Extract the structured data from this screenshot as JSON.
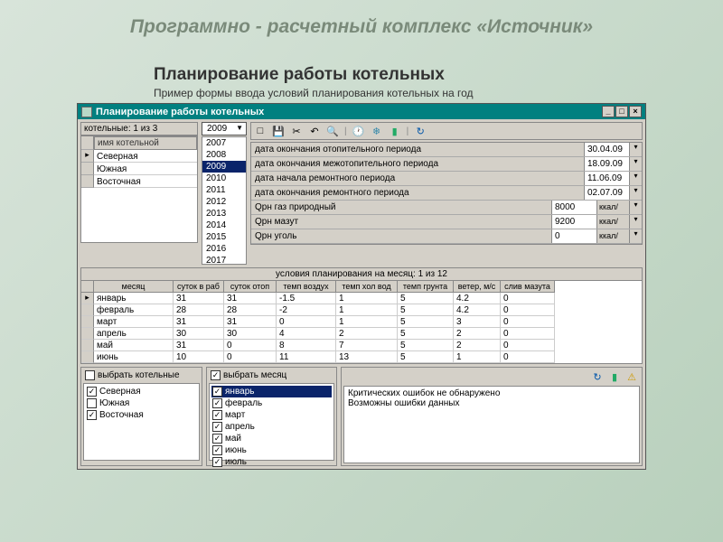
{
  "slide_title": "Программно - расчетный комплекс «Источник»",
  "section_title": "Планирование работы котельных",
  "section_sub": "Пример формы ввода условий планирования котельных на год",
  "window_title": "Планирование работы котельных",
  "left": {
    "counter": "котельные: 1 из 3",
    "col_header": "имя котельной",
    "rows": [
      "Северная",
      "Южная",
      "Восточная"
    ]
  },
  "year_selected": "2009",
  "years": [
    "2007",
    "2008",
    "2009",
    "2010",
    "2011",
    "2012",
    "2013",
    "2014",
    "2015",
    "2016",
    "2017"
  ],
  "params": [
    {
      "label": "дата окончания отопительного периода",
      "value": "30.04.09"
    },
    {
      "label": "дата окончания межотопительного периода",
      "value": "18.09.09"
    },
    {
      "label": "дата начала ремонтного периода",
      "value": "11.06.09"
    },
    {
      "label": "дата окончания ремонтного периода",
      "value": "02.07.09"
    },
    {
      "label": "Qрн газ природный",
      "value": "8000",
      "unit": "ккал/"
    },
    {
      "label": "Qрн мазут",
      "value": "9200",
      "unit": "ккал/"
    },
    {
      "label": "Qрн уголь",
      "value": "0",
      "unit": "ккал/"
    }
  ],
  "mid_title": "условия планирования на месяц: 1 из 12",
  "mid_headers": [
    "месяц",
    "суток в раб",
    "суток отоп",
    "темп воздух",
    "темп хол вод",
    "темп грунта",
    "ветер, м/с",
    "слив мазута"
  ],
  "mid_rows": [
    [
      "январь",
      "31",
      "31",
      "-1.5",
      "1",
      "5",
      "4.2",
      "0"
    ],
    [
      "февраль",
      "28",
      "28",
      "-2",
      "1",
      "5",
      "4.2",
      "0"
    ],
    [
      "март",
      "31",
      "31",
      "0",
      "1",
      "5",
      "3",
      "0"
    ],
    [
      "апрель",
      "30",
      "30",
      "4",
      "2",
      "5",
      "2",
      "0"
    ],
    [
      "май",
      "31",
      "0",
      "8",
      "7",
      "5",
      "2",
      "0"
    ],
    [
      "июнь",
      "10",
      "0",
      "11",
      "13",
      "5",
      "1",
      "0"
    ]
  ],
  "check1": {
    "title": "выбрать котельные",
    "items": [
      {
        "label": "Северная",
        "checked": true
      },
      {
        "label": "Южная",
        "checked": false
      },
      {
        "label": "Восточная",
        "checked": true
      }
    ]
  },
  "check2": {
    "title": "выбрать месяц",
    "items": [
      {
        "label": "январь",
        "checked": true,
        "selected": true
      },
      {
        "label": "февраль",
        "checked": true
      },
      {
        "label": "март",
        "checked": true
      },
      {
        "label": "апрель",
        "checked": true
      },
      {
        "label": "май",
        "checked": true
      },
      {
        "label": "июнь",
        "checked": true
      },
      {
        "label": "июль",
        "checked": true
      }
    ]
  },
  "status": {
    "l1": "Критических ошибок не обнаружено",
    "l2": "Возможны ошибки данных"
  }
}
